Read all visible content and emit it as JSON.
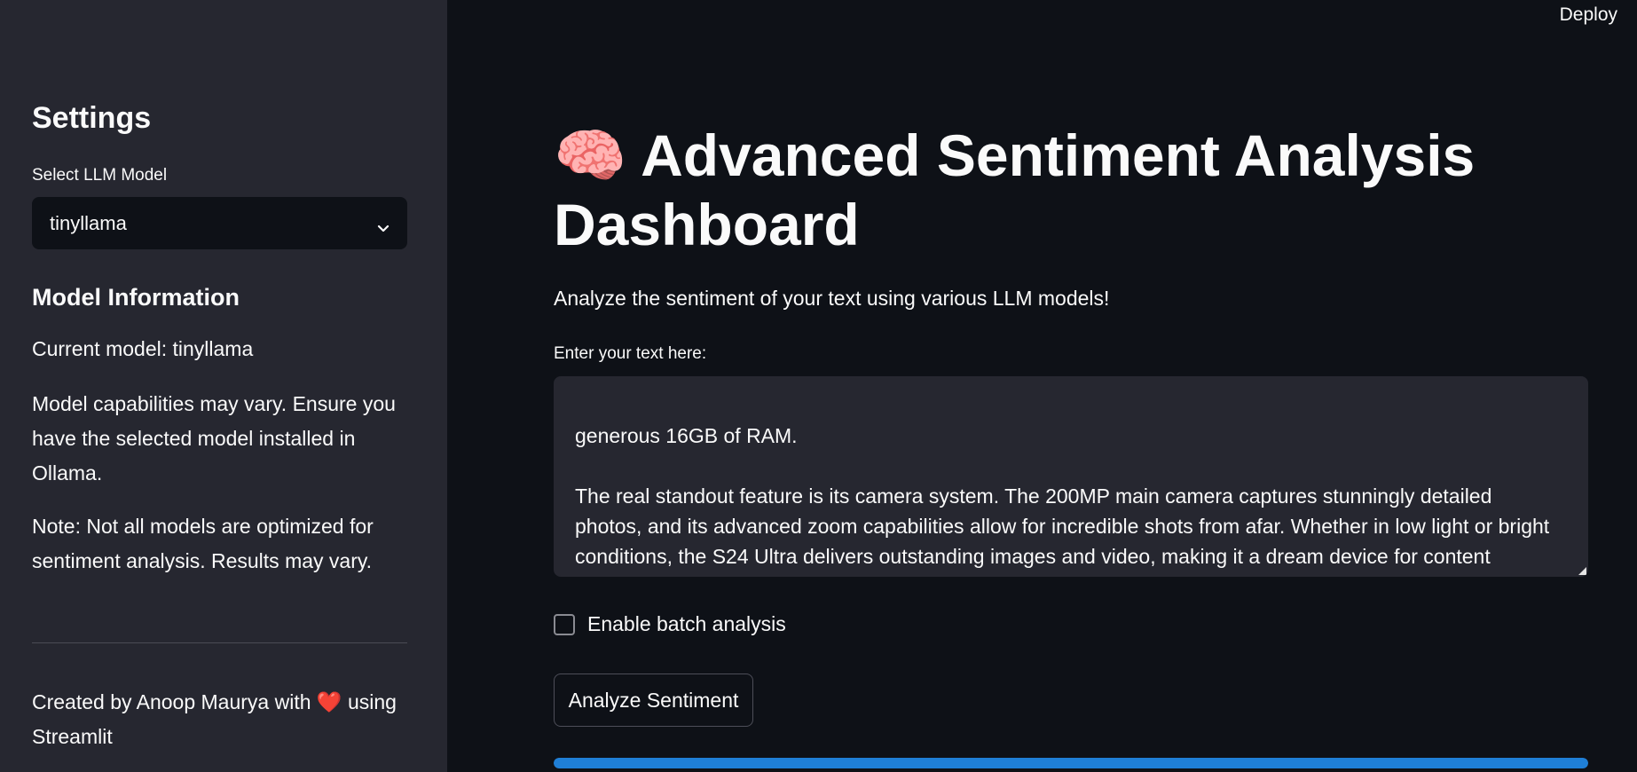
{
  "sidebar": {
    "title": "Settings",
    "select_label": "Select LLM Model",
    "select_value": "tinyllama",
    "section_title": "Model Information",
    "current_model": "Current model: tinyllama",
    "capabilities": "Model capabilities may vary. Ensure you have the selected model installed in Ollama.",
    "note": "Note: Not all models are optimized for sentiment analysis. Results may vary.",
    "credit_prefix": "Created by Anoop Maurya with",
    "credit_heart": "❤️",
    "credit_suffix": "using Streamlit"
  },
  "header": {
    "deploy_label": "Deploy"
  },
  "main": {
    "title_emoji": "🧠",
    "title": "Advanced Sentiment Analysis Dashboard",
    "subtitle": "Analyze the sentiment of your text using various LLM models!",
    "textarea_label": "Enter your text here:",
    "textarea_value": "generous 16GB of RAM.\n\nThe real standout feature is its camera system. The 200MP main camera captures stunningly detailed photos, and its advanced zoom capabilities allow for incredible shots from afar. Whether in low light or bright conditions, the S24 Ultra delivers outstanding images and video, making it a dream device for content creators and photographers alike.",
    "checkbox_label": "Enable batch analysis",
    "checkbox_checked": false,
    "button_label": "Analyze Sentiment",
    "progress": 1.0
  },
  "colors": {
    "background": "#0e1117",
    "sidebar": "#262730",
    "accent": "#1f7fd6",
    "heart": "#e0243a"
  },
  "icons": {
    "select_chevron": "chevron-down-icon",
    "title_emoji": "brain-icon"
  }
}
